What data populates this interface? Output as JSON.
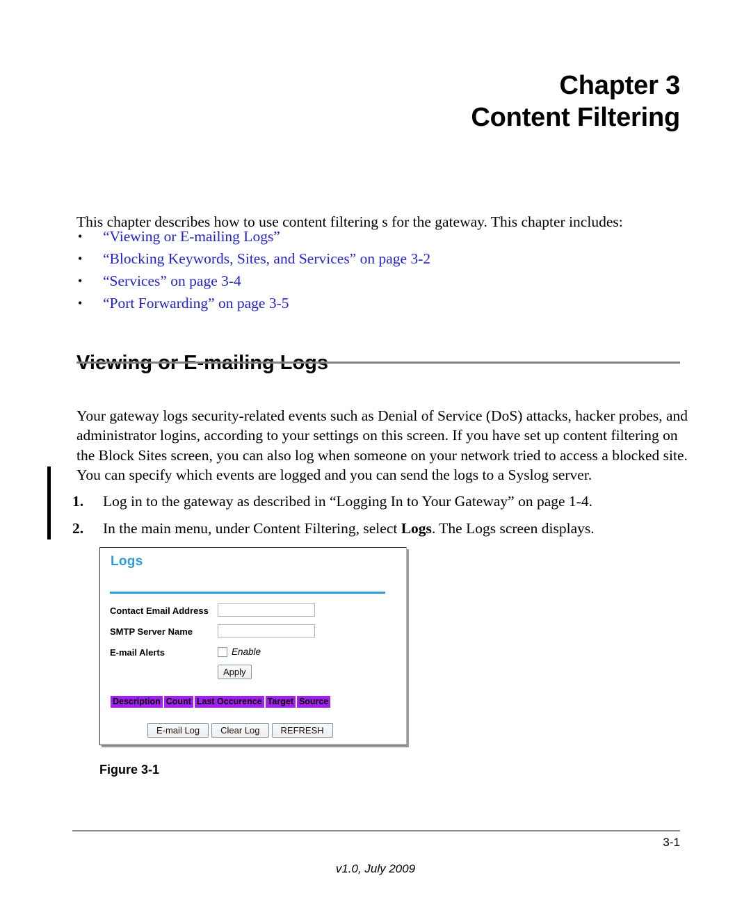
{
  "document": {
    "chapter_label": "Chapter 3",
    "chapter_name": "Content Filtering",
    "intro_paragraph": "This chapter describes how to use content filtering s for the gateway. This chapter includes:",
    "bullet_marker": "•",
    "toc_links": [
      {
        "label": "“Viewing or E-mailing Logs”"
      },
      {
        "label": "“Blocking Keywords, Sites, and Services” on page 3-2"
      },
      {
        "label": "“Services” on page 3-4"
      },
      {
        "label": "“Port Forwarding” on page 3-5"
      }
    ],
    "section": {
      "heading": "Viewing or E-mailing Logs",
      "body_paragraph": "Your gateway logs security-related events such as Denial of Service (DoS) attacks, hacker probes, and administrator logins, according to your settings on this screen. If you have set up content filtering on the Block Sites screen, you can also log when someone on your network tried to access a blocked site. You can specify which events are logged and you can send the logs to a Syslog server."
    },
    "steps": [
      {
        "number": "1.",
        "text_before": "Log in to the gateway as described in ",
        "link": "“Logging In to Your Gateway” on page 1-4",
        "text_after": "."
      },
      {
        "number": "2.",
        "text_before": "In the main menu, under Content Filtering, select ",
        "bold": "Logs",
        "text_after": ". The Logs screen displays."
      }
    ],
    "figure_caption": "Figure 3-1"
  },
  "logs_screen": {
    "title": "Logs",
    "fields": [
      {
        "label": "Contact Email Address",
        "value": "",
        "placeholder": ""
      },
      {
        "label": "SMTP Server Name",
        "value": "",
        "placeholder": ""
      }
    ],
    "alerts": {
      "label": "E-mail Alerts",
      "checkbox_label": "Enable",
      "checked": false
    },
    "apply_button": "Apply",
    "log_table": {
      "columns": [
        "Description",
        "Count",
        "Last Occurence",
        "Target",
        "Source"
      ],
      "rows": []
    },
    "action_buttons": [
      "E-mail Log",
      "Clear Log",
      "REFRESH"
    ]
  },
  "footer": {
    "page_number": "3-1",
    "version": "v1.0, July 2009"
  },
  "colors": {
    "link": "#2222CC",
    "logs_accent": "#2B9ADE",
    "table_header": "#A21FEE",
    "rule": "#808080"
  }
}
